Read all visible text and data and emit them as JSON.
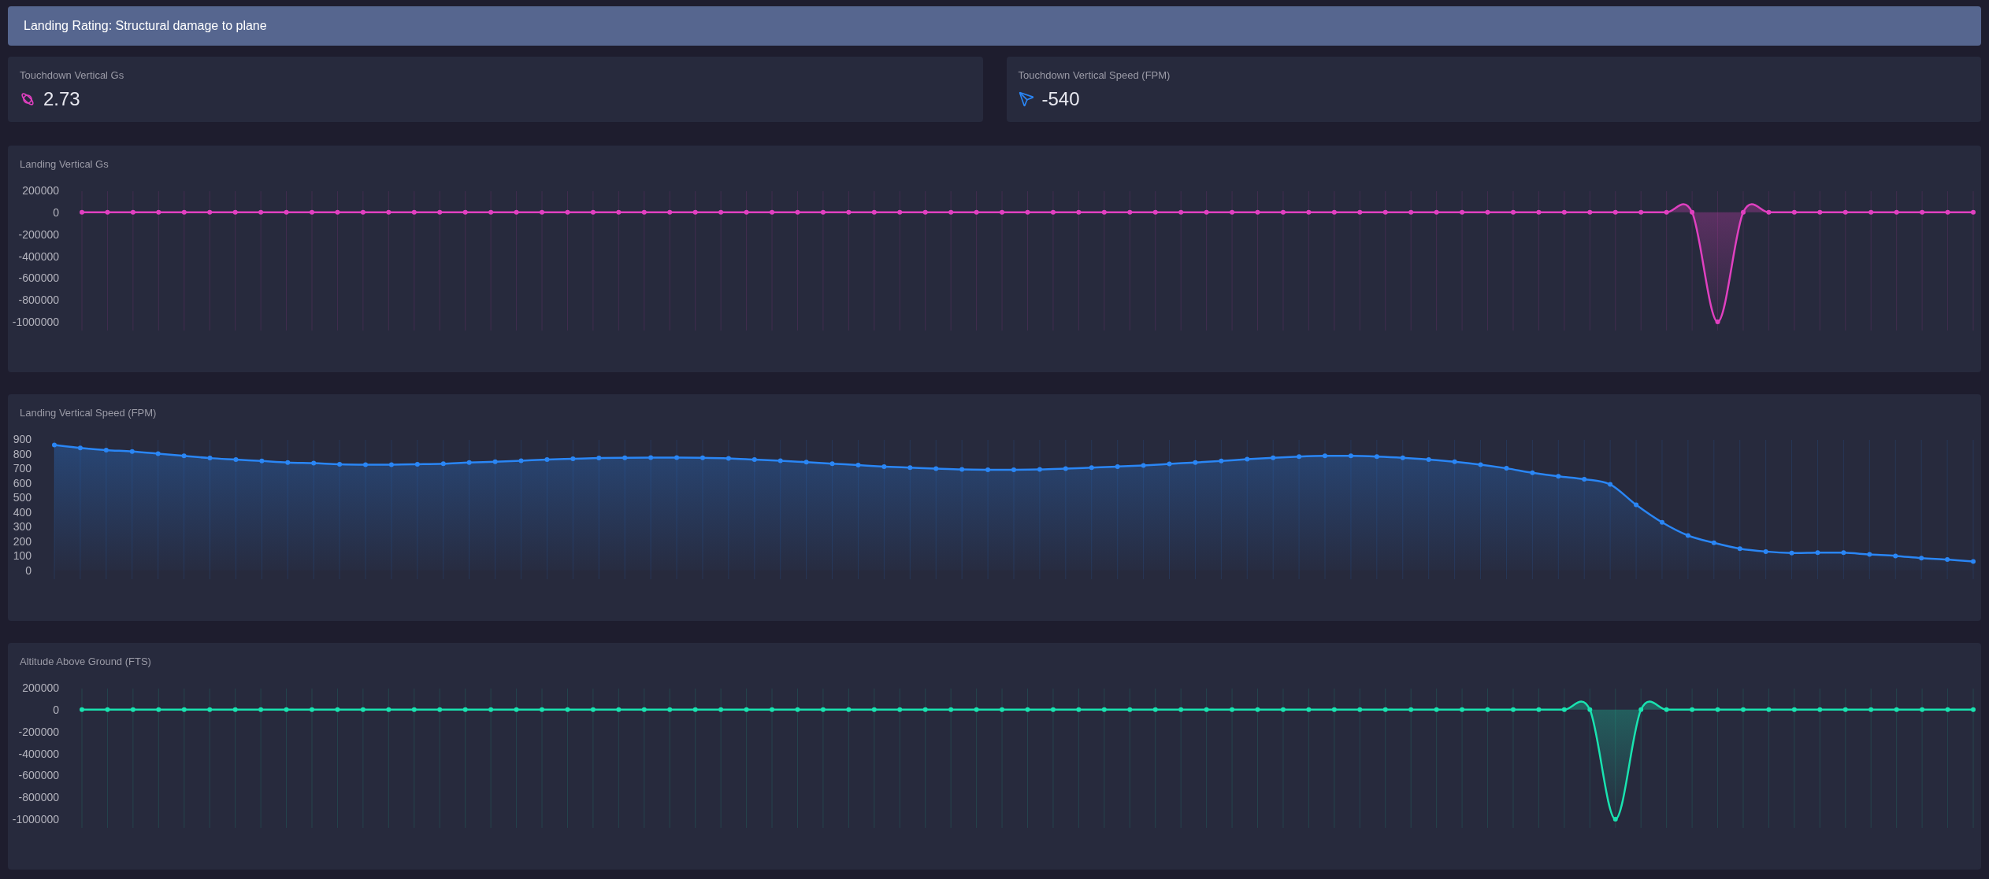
{
  "banner": {
    "text": "Landing Rating: Structural damage to plane"
  },
  "stats": [
    {
      "kind": "gs",
      "label": "Touchdown Vertical Gs",
      "value": "2.73",
      "color": "#e040c0"
    },
    {
      "kind": "speed",
      "label": "Touchdown Vertical Speed (FPM)",
      "value": "-540",
      "color": "#2a86f5"
    }
  ],
  "charts": [
    {
      "title": "Landing Vertical Gs",
      "chart_data": {
        "type": "area",
        "grid": true,
        "ylim": [
          -1000000,
          200000
        ],
        "yticks": [
          200000,
          0,
          -200000,
          -400000,
          -600000,
          -800000,
          -1000000
        ],
        "series": [
          {
            "color": "#e040c0",
            "values": [
              0,
              0,
              0,
              0,
              0,
              0,
              0,
              0,
              0,
              0,
              0,
              0,
              0,
              0,
              0,
              0,
              0,
              0,
              0,
              0,
              0,
              0,
              0,
              0,
              0,
              0,
              0,
              0,
              0,
              0,
              0,
              0,
              0,
              0,
              0,
              0,
              0,
              0,
              0,
              0,
              0,
              0,
              0,
              0,
              0,
              0,
              0,
              0,
              0,
              0,
              0,
              0,
              0,
              0,
              0,
              0,
              0,
              0,
              0,
              0,
              0,
              0,
              0,
              0,
              -1000000,
              0,
              0,
              0,
              0,
              0,
              0,
              0,
              0,
              0,
              0
            ]
          }
        ]
      }
    },
    {
      "title": "Landing Vertical Speed (FPM)",
      "chart_data": {
        "type": "area",
        "grid": true,
        "ylim": [
          0,
          900
        ],
        "yticks": [
          900,
          800,
          700,
          600,
          500,
          400,
          300,
          200,
          100,
          0
        ],
        "series": [
          {
            "color": "#2a86f5",
            "values": [
              860,
              840,
              825,
              815,
              800,
              785,
              770,
              760,
              750,
              740,
              735,
              728,
              725,
              725,
              728,
              732,
              740,
              745,
              752,
              760,
              765,
              770,
              772,
              773,
              773,
              772,
              768,
              760,
              752,
              742,
              732,
              722,
              712,
              705,
              698,
              692,
              690,
              690,
              692,
              698,
              705,
              712,
              720,
              730,
              740,
              750,
              762,
              772,
              780,
              785,
              785,
              780,
              772,
              760,
              745,
              725,
              700,
              670,
              645,
              625,
              590,
              450,
              330,
              240,
              190,
              150,
              130,
              120,
              122,
              122,
              110,
              100,
              85,
              75,
              62
            ]
          }
        ]
      }
    },
    {
      "title": "Altitude Above Ground (FTS)",
      "chart_data": {
        "type": "area",
        "grid": true,
        "ylim": [
          -1000000,
          200000
        ],
        "yticks": [
          200000,
          0,
          -200000,
          -400000,
          -600000,
          -800000,
          -1000000
        ],
        "series": [
          {
            "color": "#19e3b0",
            "values": [
              0,
              0,
              0,
              0,
              0,
              0,
              0,
              0,
              0,
              0,
              0,
              0,
              0,
              0,
              0,
              0,
              0,
              0,
              0,
              0,
              0,
              0,
              0,
              0,
              0,
              0,
              0,
              0,
              0,
              0,
              0,
              0,
              0,
              0,
              0,
              0,
              0,
              0,
              0,
              0,
              0,
              0,
              0,
              0,
              0,
              0,
              0,
              0,
              0,
              0,
              0,
              0,
              0,
              0,
              0,
              0,
              0,
              0,
              0,
              0,
              -1000000,
              0,
              0,
              0,
              0,
              0,
              0,
              0,
              0,
              0,
              0,
              0,
              0,
              0,
              0
            ]
          }
        ]
      }
    }
  ]
}
